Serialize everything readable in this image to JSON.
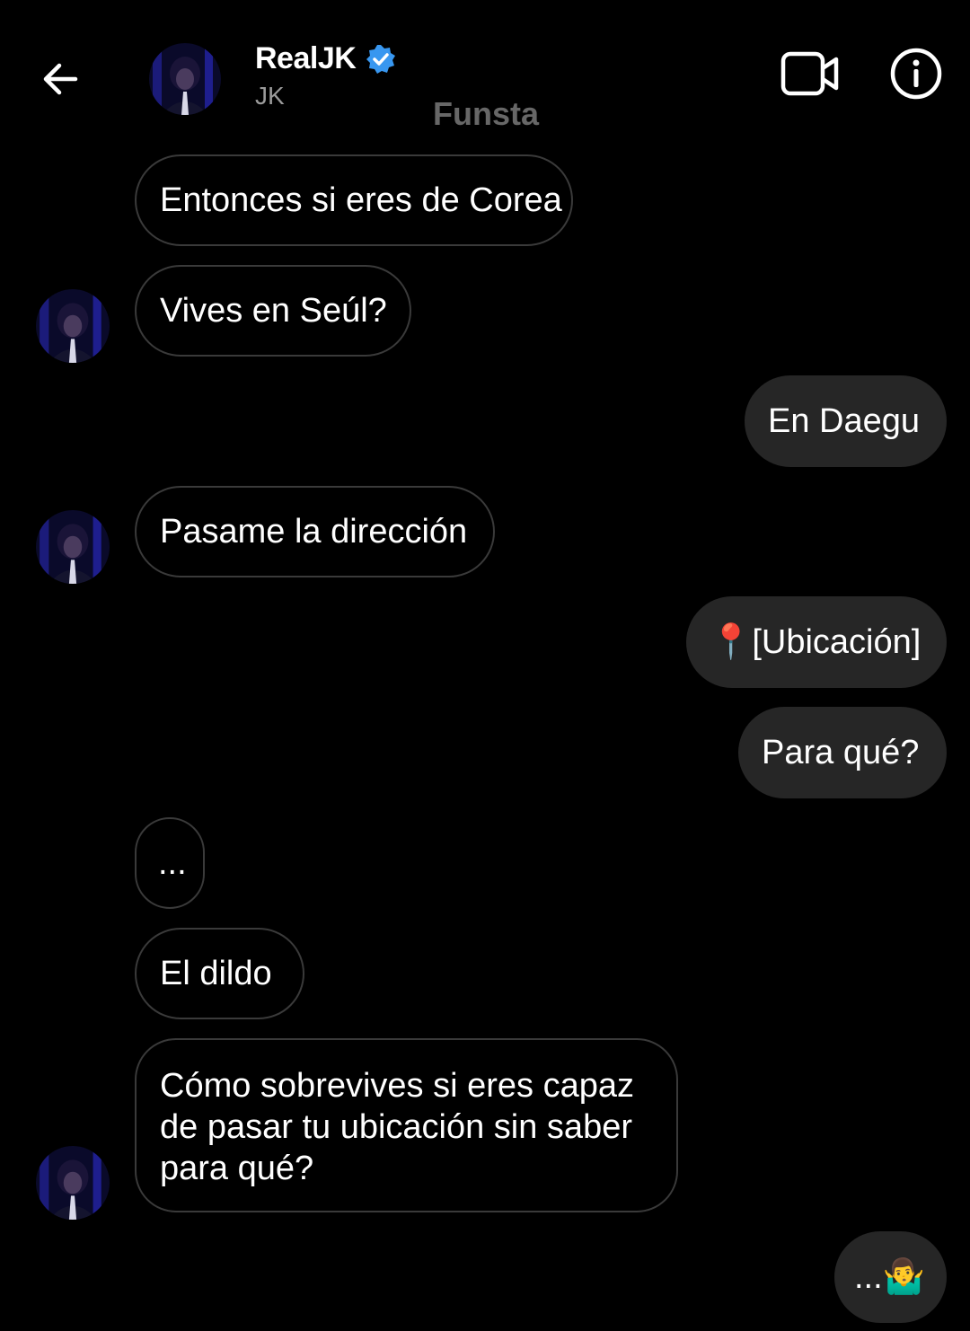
{
  "header": {
    "title": "RealJK",
    "subtitle": "JK",
    "verified_color": "#3897f0",
    "icons": [
      "back-arrow-icon",
      "verified-badge-icon",
      "video-camera-icon",
      "info-icon"
    ]
  },
  "watermark": "Funsta",
  "messages": [
    {
      "from": "them",
      "text": "Entonces si eres de Corea"
    },
    {
      "from": "them",
      "text": "Vives en Seúl?"
    },
    {
      "from": "me",
      "text": "En Daegu"
    },
    {
      "from": "them",
      "text": "Pasame la dirección"
    },
    {
      "from": "me",
      "text": "📍[Ubicación]"
    },
    {
      "from": "me",
      "text": "Para qué?"
    },
    {
      "from": "them",
      "text": "..."
    },
    {
      "from": "them",
      "text": "El dildo"
    },
    {
      "from": "them",
      "text": "Cómo sobrevives si eres capaz de pasar tu ubicación sin saber para qué?"
    },
    {
      "from": "me",
      "text": "...🤷‍♂️"
    }
  ],
  "colors": {
    "background": "#000000",
    "outgoing_bubble": "#262626",
    "incoming_border": "#3a3a3a",
    "subtitle": "#9a9a9a"
  }
}
